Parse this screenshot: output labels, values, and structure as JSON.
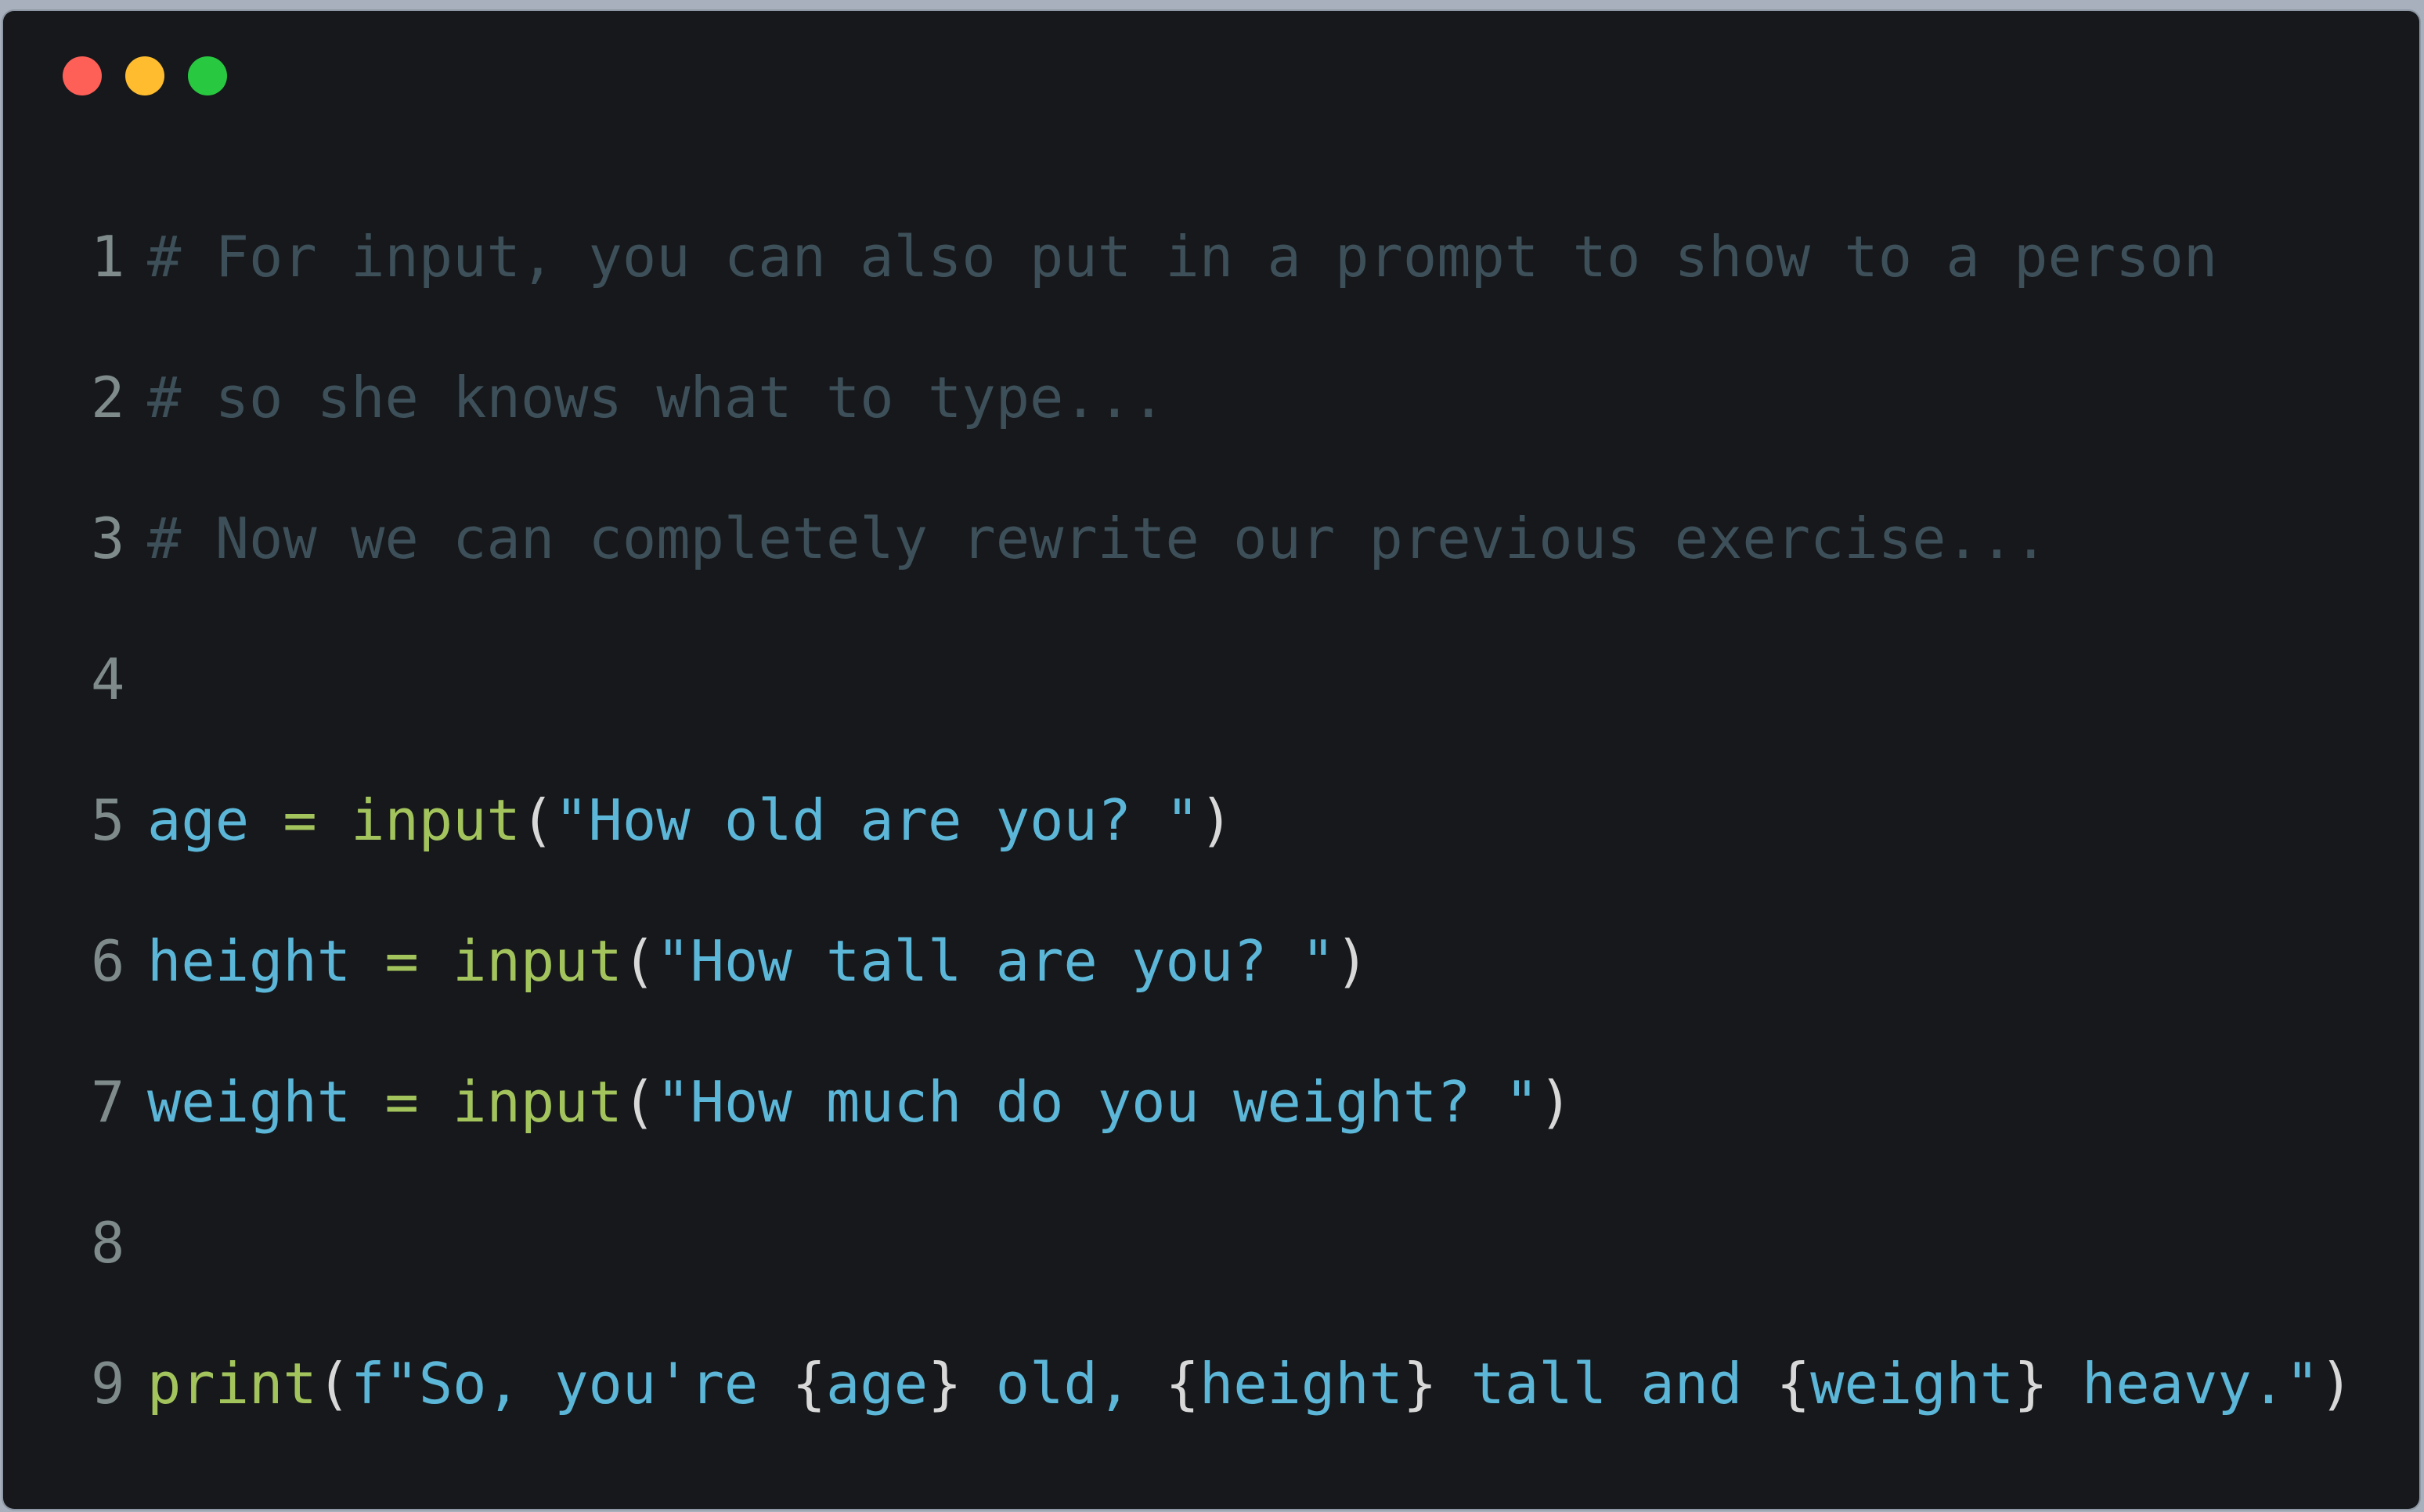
{
  "window": {
    "controls": {
      "close": "#fe5f57",
      "minimize": "#febc2e",
      "maximize": "#28c840"
    },
    "theme": {
      "background": "#16181b",
      "comment": "#3d4f58",
      "identifier": "#5bb6d8",
      "function": "#a3c45d",
      "string": "#5bb6d8",
      "punctuation": "#d8d8d8",
      "line_number": "#7f8b8b"
    }
  },
  "code": {
    "lines": [
      {
        "n": "1",
        "comment": "# For input, you can also put in a prompt to show to a person"
      },
      {
        "n": "2",
        "comment": "# so she knows what to type..."
      },
      {
        "n": "3",
        "comment": "# Now we can completely rewrite our previous exercise..."
      },
      {
        "n": "4"
      },
      {
        "n": "5",
        "var": "age",
        "op": " = ",
        "func": "input",
        "open": "(",
        "str": "\"How old are you? \"",
        "close": ")"
      },
      {
        "n": "6",
        "var": "height",
        "op": " = ",
        "func": "input",
        "open": "(",
        "str": "\"How tall are you? \"",
        "close": ")"
      },
      {
        "n": "7",
        "var": "weight",
        "op": " = ",
        "func": "input",
        "open": "(",
        "str": "\"How much do you weight? \"",
        "close": ")"
      },
      {
        "n": "8"
      },
      {
        "n": "9",
        "func": "print",
        "open": "(",
        "p1": "f\"So, you're ",
        "b1o": "{",
        "v1": "age",
        "b1c": "}",
        "p2": " old, ",
        "b2o": "{",
        "v2": "height",
        "b2c": "}",
        "p3": " tall and ",
        "b3o": "{",
        "v3": "weight",
        "b3c": "}",
        "p4": " heavy.\"",
        "close": ")"
      }
    ]
  }
}
